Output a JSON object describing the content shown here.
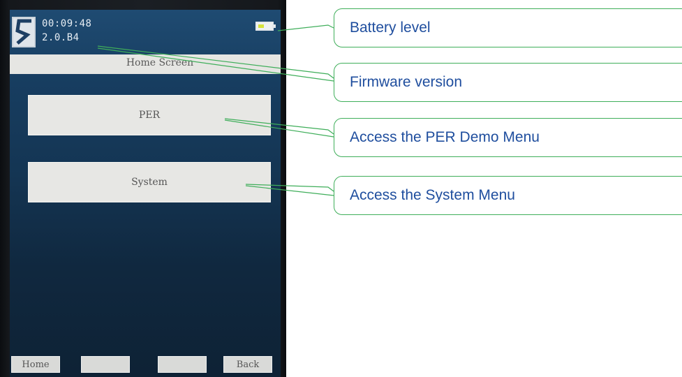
{
  "device": {
    "clock": "00:09:48",
    "firmware": "2.0.B4",
    "battery_level": 0.45,
    "title": "Home Screen",
    "menu": {
      "per": "PER",
      "system": "System"
    },
    "softkeys": [
      "Home",
      "",
      "",
      "Back"
    ],
    "logo_icon": "company-logo-icon",
    "battery_icon": "battery-icon"
  },
  "callouts": {
    "battery": "Battery level",
    "firmware": "Firmware version",
    "per": "Access the PER Demo Menu",
    "system": "Access the System Menu"
  },
  "colors": {
    "screen_bg": "#173d60",
    "callout_border": "#3fae5a",
    "callout_text": "#1f4e9e",
    "battery_fill": "#d6e23a"
  }
}
